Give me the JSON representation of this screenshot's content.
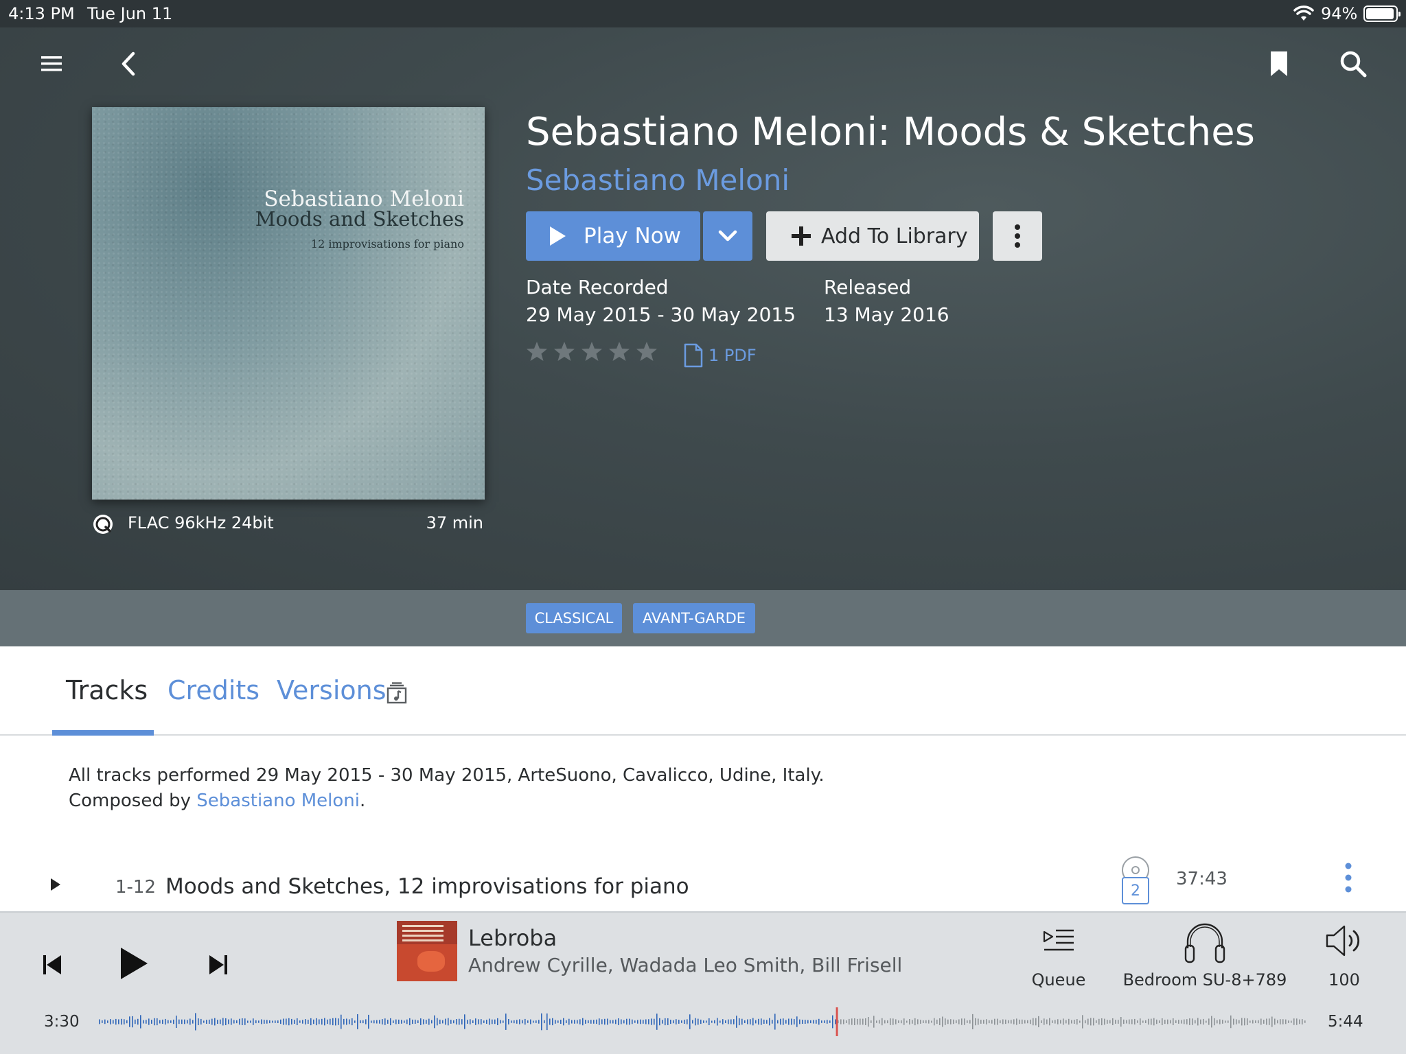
{
  "statusbar": {
    "time": "4:13 PM",
    "date": "Tue Jun 11",
    "battery": "94%"
  },
  "nav": {
    "menu_icon": "hamburger-icon",
    "back_icon": "chevron-left-icon",
    "bookmark_icon": "bookmark-icon",
    "search_icon": "search-icon"
  },
  "album": {
    "cover": {
      "artist": "Sebastiano Meloni",
      "title": "Moods and Sketches",
      "subtitle": "12 improvisations for piano"
    },
    "title": "Sebastiano Meloni: Moods & Sketches",
    "artist": "Sebastiano Meloni",
    "quality": "FLAC 96kHz 24bit",
    "duration": "37 min",
    "date_recorded_label": "Date Recorded",
    "date_recorded": "29 May 2015 - 30 May 2015",
    "released_label": "Released",
    "released": "13 May 2016",
    "rating": 0,
    "rating_max": 5,
    "pdf_label": "1 PDF"
  },
  "actions": {
    "play_now": "Play Now",
    "add_to_library": "Add To Library"
  },
  "genres": [
    "CLASSICAL",
    "AVANT-GARDE"
  ],
  "tabs": {
    "tracks": "Tracks",
    "credits": "Credits",
    "versions": "Versions",
    "active": "Tracks"
  },
  "notes": {
    "line1": "All tracks performed 29 May 2015 - 30 May 2015, ArteSuono, Cavalicco, Udine, Italy.",
    "composed_prefix": "Composed by ",
    "composer": "Sebastiano Meloni",
    "composed_suffix": "."
  },
  "tracks": [
    {
      "number": "1-12",
      "title": "Moods and Sketches, 12 improvisations for piano",
      "disc": "2",
      "duration": "37:43"
    }
  ],
  "player": {
    "now_playing": {
      "title": "Lebroba",
      "artist": "Andrew Cyrille, Wadada Leo Smith, Bill Frisell"
    },
    "queue_label": "Queue",
    "device": "Bedroom SU-8+789",
    "volume": "100",
    "elapsed": "3:30",
    "total": "5:44",
    "progress": 0.61
  },
  "colors": {
    "accent": "#5d8fd8",
    "link": "#6b9be0",
    "playhead": "#d9534f",
    "hero_bg": "#3f4a4d"
  }
}
